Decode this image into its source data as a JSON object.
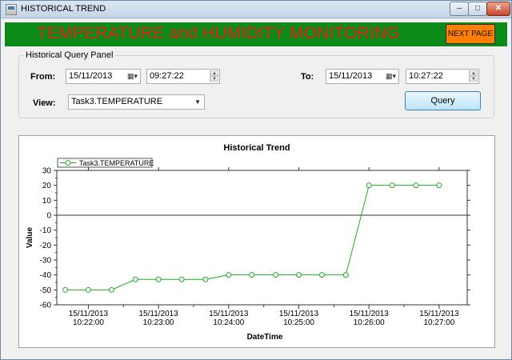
{
  "window": {
    "title": "HISTORICAL TREND",
    "min_glyph": "–",
    "max_glyph": "□",
    "close_glyph": "✕"
  },
  "header": {
    "title": "TEMPERATURE and HUMIDITY MONITORING",
    "next_page": "NEXT PAGE",
    "bar_color": "#0b8a19",
    "title_color": "#e2231a",
    "button_color": "#ff7f00"
  },
  "query_panel": {
    "legend": "Historical Query Panel",
    "from_label": "From:",
    "from_date": "15/11/2013",
    "from_time": "09:27:22",
    "to_label": "To:",
    "to_date": "15/11/2013",
    "to_time": "10:27:22",
    "view_label": "View:",
    "view_value": "Task3.TEMPERATURE",
    "query_button": "Query"
  },
  "chart_data": {
    "type": "line",
    "title": "Historical Trend",
    "xlabel": "DateTime",
    "ylabel": "Value",
    "ylim": [
      -60,
      30
    ],
    "y_ticks": [
      30,
      20,
      10,
      0,
      -10,
      -20,
      -30,
      -40,
      -50,
      -60
    ],
    "x_range_minutes": [
      21.55,
      27.4
    ],
    "x_tick_labels": [
      {
        "date": "15/11/2013",
        "time": "10:22:00",
        "minute": 22
      },
      {
        "date": "15/11/2013",
        "time": "10:23:00",
        "minute": 23
      },
      {
        "date": "15/11/2013",
        "time": "10:24:00",
        "minute": 24
      },
      {
        "date": "15/11/2013",
        "time": "10:25:00",
        "minute": 25
      },
      {
        "date": "15/11/2013",
        "time": "10:26:00",
        "minute": 26
      },
      {
        "date": "15/11/2013",
        "time": "10:27:00",
        "minute": 27
      }
    ],
    "grid": false,
    "zero_line": true,
    "legend_position": "top-left",
    "series": [
      {
        "name": "Task3.TEMPERATURE",
        "color": "#22aa22",
        "x_minutes": [
          21.67,
          22.0,
          22.33,
          22.67,
          23.0,
          23.33,
          23.67,
          24.0,
          24.33,
          24.67,
          25.0,
          25.33,
          25.67,
          26.0,
          26.33,
          26.67,
          27.0
        ],
        "values": [
          -50,
          -50,
          -50,
          -43,
          -43,
          -43,
          -43,
          -40,
          -40,
          -40,
          -40,
          -40,
          -40,
          20,
          20,
          20,
          20
        ]
      }
    ]
  }
}
